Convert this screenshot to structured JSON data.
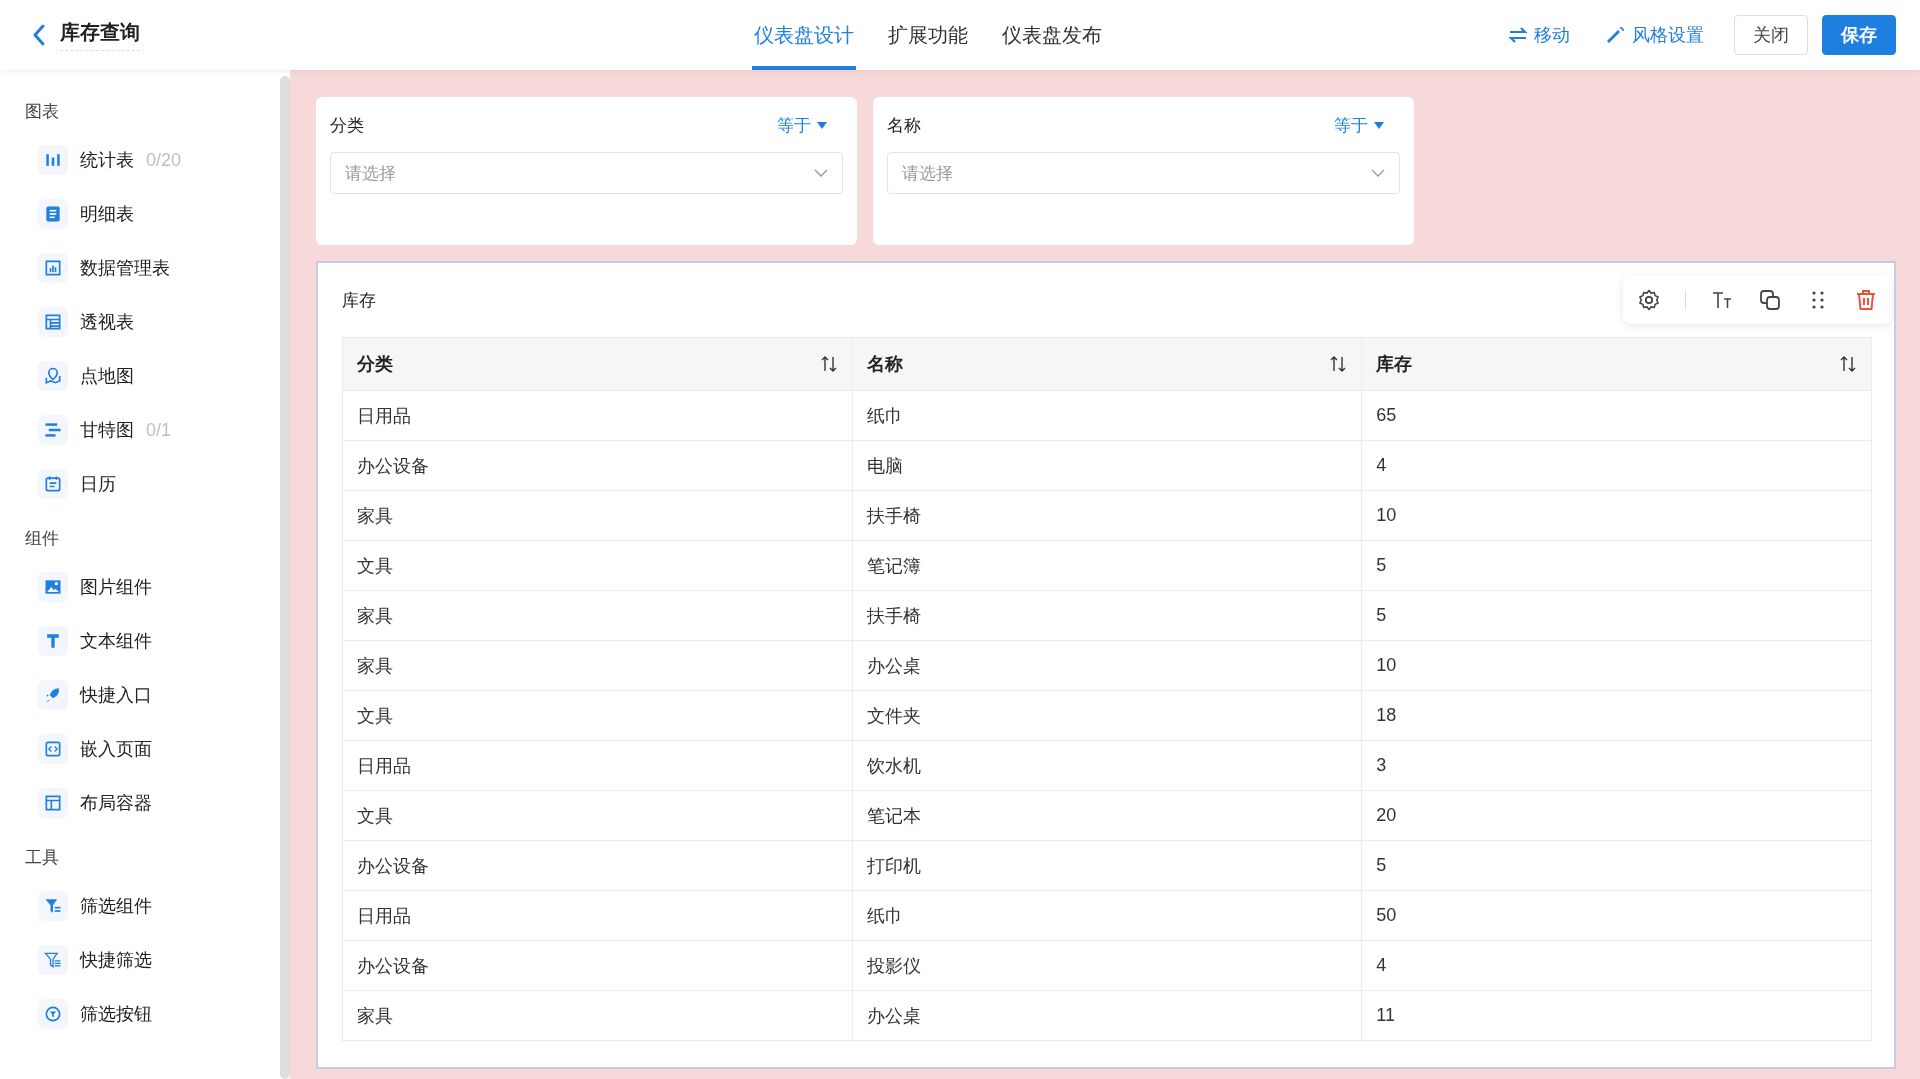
{
  "header": {
    "back_title": "库存查询",
    "tabs": [
      {
        "label": "仪表盘设计",
        "selected": true
      },
      {
        "label": "扩展功能",
        "selected": false
      },
      {
        "label": "仪表盘发布",
        "selected": false
      }
    ],
    "actions": [
      {
        "label": "移动"
      },
      {
        "label": "风格设置"
      }
    ],
    "buttons": [
      {
        "label": "关闭",
        "kind": "default"
      },
      {
        "label": "保存",
        "kind": "primary"
      }
    ]
  },
  "sidebar": {
    "sections": [
      {
        "title": "图表",
        "items": [
          {
            "label": "统计表",
            "count": "0/20"
          },
          {
            "label": "明细表"
          },
          {
            "label": "数据管理表"
          },
          {
            "label": "透视表"
          },
          {
            "label": "点地图"
          },
          {
            "label": "甘特图",
            "count": "0/1"
          },
          {
            "label": "日历"
          }
        ]
      },
      {
        "title": "组件",
        "items": [
          {
            "label": "图片组件"
          },
          {
            "label": "文本组件"
          },
          {
            "label": "快捷入口"
          },
          {
            "label": "嵌入页面"
          },
          {
            "label": "布局容器"
          }
        ]
      },
      {
        "title": "工具",
        "items": [
          {
            "label": "筛选组件"
          },
          {
            "label": "快捷筛选"
          },
          {
            "label": "筛选按钮"
          }
        ]
      }
    ]
  },
  "filters": [
    {
      "label": "分类",
      "operator": "等于",
      "placeholder": "请选择"
    },
    {
      "label": "名称",
      "operator": "等于",
      "placeholder": "请选择"
    }
  ],
  "table": {
    "title": "库存",
    "columns": [
      "分类",
      "名称",
      "库存"
    ],
    "rows": [
      [
        "日用品",
        "纸巾",
        "65"
      ],
      [
        "办公设备",
        "电脑",
        "4"
      ],
      [
        "家具",
        "扶手椅",
        "10"
      ],
      [
        "文具",
        "笔记簿",
        "5"
      ],
      [
        "家具",
        "扶手椅",
        "5"
      ],
      [
        "家具",
        "办公桌",
        "10"
      ],
      [
        "文具",
        "文件夹",
        "18"
      ],
      [
        "日用品",
        "饮水机",
        "3"
      ],
      [
        "文具",
        "笔记本",
        "20"
      ],
      [
        "办公设备",
        "打印机",
        "5"
      ],
      [
        "日用品",
        "纸巾",
        "50"
      ],
      [
        "办公设备",
        "投影仪",
        "4"
      ],
      [
        "家具",
        "办公桌",
        "11"
      ]
    ]
  }
}
